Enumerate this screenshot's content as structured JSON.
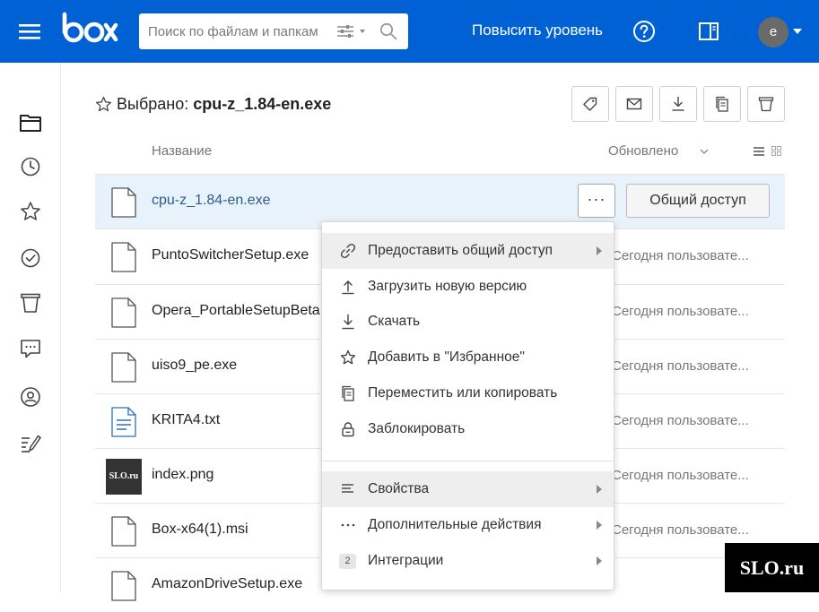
{
  "header": {
    "search_placeholder": "Поиск по файлам и папкам",
    "upgrade_label": "Повысить уровень",
    "avatar_letter": "e",
    "brand_color": "#0061d5"
  },
  "nav": {
    "icons": [
      "folder-icon",
      "clock-icon",
      "star-icon",
      "check-circle-icon",
      "trash-icon",
      "chat-icon",
      "user-circle-icon",
      "notes-icon"
    ]
  },
  "toolbar": {
    "selected_prefix": "Выбрано:",
    "selected_name": "cpu-z_1.84-en.exe",
    "buttons": [
      "tag-icon",
      "mail-icon",
      "download-icon",
      "copy-icon",
      "trash-icon"
    ]
  },
  "list": {
    "col_name": "Название",
    "col_updated": "Обновлено",
    "rows": [
      {
        "name": "cpu-z_1.84-en.exe",
        "updated": "",
        "selected": true
      },
      {
        "name": "PuntoSwitcherSetup.exe",
        "updated": "Сегодня пользовате..."
      },
      {
        "name": "Opera_PortableSetupBeta",
        "updated": "Сегодня пользовате..."
      },
      {
        "name": "uiso9_pe.exe",
        "updated": "Сегодня пользовате..."
      },
      {
        "name": "KRITA4.txt",
        "updated": "Сегодня пользовате..."
      },
      {
        "name": "index.png",
        "updated": "Сегодня пользовате...",
        "thumb": "SLO.ru"
      },
      {
        "name": "Box-x64(1).msi",
        "updated": "Сегодня пользовате..."
      },
      {
        "name": "AmazonDriveSetup.exe",
        "updated": ""
      }
    ],
    "more_label": "···",
    "share_label": "Общий доступ"
  },
  "menu": {
    "items": [
      {
        "label": "Предоставить общий доступ",
        "icon": "link-icon",
        "submenu": true,
        "highlighted": true
      },
      {
        "label": "Загрузить новую версию",
        "icon": "upload-icon"
      },
      {
        "label": "Скачать",
        "icon": "download-icon"
      },
      {
        "label": "Добавить в \"Избранное\"",
        "icon": "star-icon"
      },
      {
        "label": "Переместить или копировать",
        "icon": "copy-icon"
      },
      {
        "label": "Заблокировать",
        "icon": "lock-icon"
      },
      {
        "label": "Свойства",
        "icon": "properties-icon",
        "submenu": true,
        "highlighted": true
      },
      {
        "label": "Дополнительные действия",
        "icon": "ellipsis-icon",
        "submenu": true
      },
      {
        "label": "Интеграции",
        "badge": "2",
        "submenu": true
      }
    ]
  },
  "watermark": "SLO.ru"
}
